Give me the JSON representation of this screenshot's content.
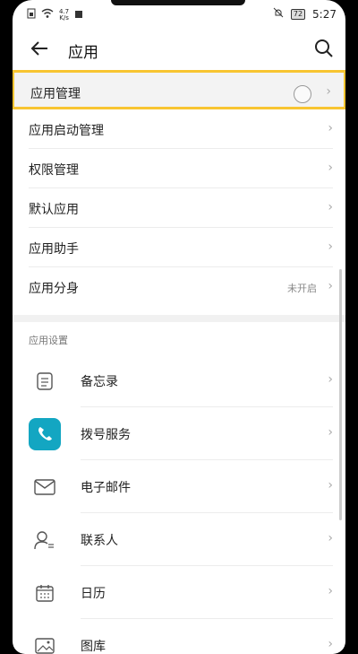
{
  "status": {
    "net_speed_value": "4.7",
    "net_speed_unit": "K/s",
    "battery": "72",
    "time": "5:27"
  },
  "header": {
    "title": "应用"
  },
  "menu": [
    {
      "label": "应用管理",
      "value": ""
    },
    {
      "label": "应用启动管理",
      "value": ""
    },
    {
      "label": "权限管理",
      "value": ""
    },
    {
      "label": "默认应用",
      "value": ""
    },
    {
      "label": "应用助手",
      "value": ""
    },
    {
      "label": "应用分身",
      "value": "未开启"
    }
  ],
  "section_title": "应用设置",
  "apps": [
    {
      "label": "备忘录",
      "icon": "notes-icon"
    },
    {
      "label": "拨号服务",
      "icon": "phone-icon"
    },
    {
      "label": "电子邮件",
      "icon": "mail-icon"
    },
    {
      "label": "联系人",
      "icon": "contacts-icon"
    },
    {
      "label": "日历",
      "icon": "calendar-icon"
    },
    {
      "label": "图库",
      "icon": "gallery-icon"
    }
  ],
  "colors": {
    "highlight": "#f8c531",
    "phone_icon_bg": "#13a6c2"
  }
}
